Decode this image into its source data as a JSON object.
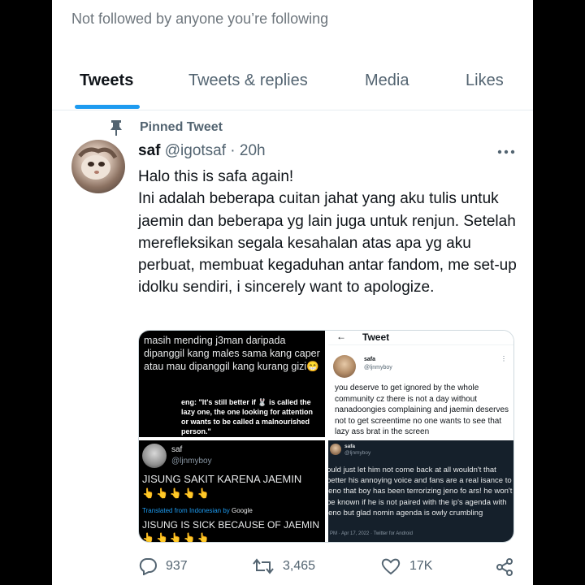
{
  "profile": {
    "follow_note": "Not followed by anyone you’re following"
  },
  "tabs": [
    {
      "label": "Tweets",
      "active": true
    },
    {
      "label": "Tweets & replies",
      "active": false
    },
    {
      "label": "Media",
      "active": false
    },
    {
      "label": "Likes",
      "active": false
    }
  ],
  "pinned_label": "Pinned Tweet",
  "tweet": {
    "name": "saf",
    "handle": "@igotsaf",
    "separator": " · ",
    "time": "20h",
    "text_lines": [
      "Halo this is safa again!",
      "Ini adalah beberapa cuitan jahat yang aku tulis untuk jaemin dan beberapa yg lain juga untuk renjun. Setelah merefleksikan segala kesahalan atas apa yg aku perbuat, membuat kegaduhan antar fandom, me set-up idolku sendiri, i sincerely want to apologize."
    ],
    "media": {
      "img1": {
        "text": "masih mending j3man daripada dipanggil kang males sama kang caper atau mau dipanggil kang kurang gizi😁",
        "translation": "eng: \"It's still better if 🐰 is called the lazy one, the one looking for attention or wants to be called a malnourished person.\""
      },
      "img2": {
        "back": "←",
        "title": "Tweet",
        "name": "safa",
        "handle": "@ljnmyboy",
        "dots": "⋮",
        "text": "you deserve to get ignored by the whole community cz there is not a day without nanadoongies complaining and jaemin deserves not to get screentime no one wants to see that lazy ass brat in the screen"
      },
      "img3": {
        "name": "saf",
        "handle": "@ljnmyboy",
        "text1": "JISUNG SAKIT KARENA JAEMIN",
        "emoji1": "👆👆👆👆👆",
        "translated_prefix": "Translated from Indonesian by ",
        "translated_by": "Google",
        "text2": "JISUNG IS SICK BECAUSE OF JAEMIN",
        "emoji2": "👆👆👆👆👆"
      },
      "img4": {
        "name": "safa",
        "handle": "@ljnmyboy",
        "text": "ould just let him not come back at all wouldn't that better his annoying voice and fans are a real isance to jeno that boy has been terrorizing jeno fo ars! he won't be known if he is not paired with the ip's agenda with jeno but glad nomin agenda is owly crumbling",
        "meta": "PM · Apr 17, 2022 · Twitter for Android"
      }
    },
    "stats": {
      "replies": "937",
      "retweets": "3,465",
      "likes": "17K"
    }
  },
  "colors": {
    "accent": "#1d9bf0",
    "text_primary": "#0f1419",
    "text_secondary": "#536471"
  }
}
